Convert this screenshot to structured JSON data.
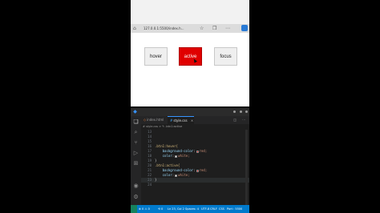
{
  "browser": {
    "url": "127.0.0.1:5500/index.h...",
    "icons": [
      "home-icon",
      "star-icon",
      "tabs-icon",
      "more-icon",
      "extension-icon"
    ]
  },
  "demo": {
    "buttons": [
      {
        "label": "hover",
        "state": "default"
      },
      {
        "label": "active",
        "state": "active"
      },
      {
        "label": "focus",
        "state": "default"
      }
    ],
    "active_color": "#e00000"
  },
  "vscode": {
    "tabs": [
      {
        "label": "index.html",
        "current": false
      },
      {
        "label": "style.css",
        "current": true
      }
    ],
    "breadcrumb": "# style.css > ✎ .btn1:active",
    "code": [
      {
        "ln": "13",
        "text": ""
      },
      {
        "ln": "14",
        "text": ""
      },
      {
        "ln": "15",
        "text": ""
      },
      {
        "ln": "16",
        "selector": ".btn1:hover{"
      },
      {
        "ln": "17",
        "prop": "background-color",
        "swatch": "#ff0000",
        "value": "red;"
      },
      {
        "ln": "18",
        "prop": "color",
        "swatch": "#ffffff",
        "value": "white;"
      },
      {
        "ln": "19",
        "punct": "}"
      },
      {
        "ln": "20",
        "selector": ".btn1:active{"
      },
      {
        "ln": "21",
        "prop": "background-color",
        "swatch": "#ff0000",
        "value": "red;"
      },
      {
        "ln": "22",
        "prop": "color",
        "swatch": "#ffffff",
        "value": "white;"
      },
      {
        "ln": "23",
        "punct": "}"
      },
      {
        "ln": "24",
        "text": ""
      }
    ],
    "status": {
      "errors": "⊗ 0 ⚠ 0",
      "sync": "⟲ 0",
      "position": "Ln 23, Col 2",
      "spaces": "Spaces: 4",
      "encoding": "UTF-8",
      "eol": "CRLF",
      "language": "CSS",
      "port": "Port : 5500"
    }
  }
}
